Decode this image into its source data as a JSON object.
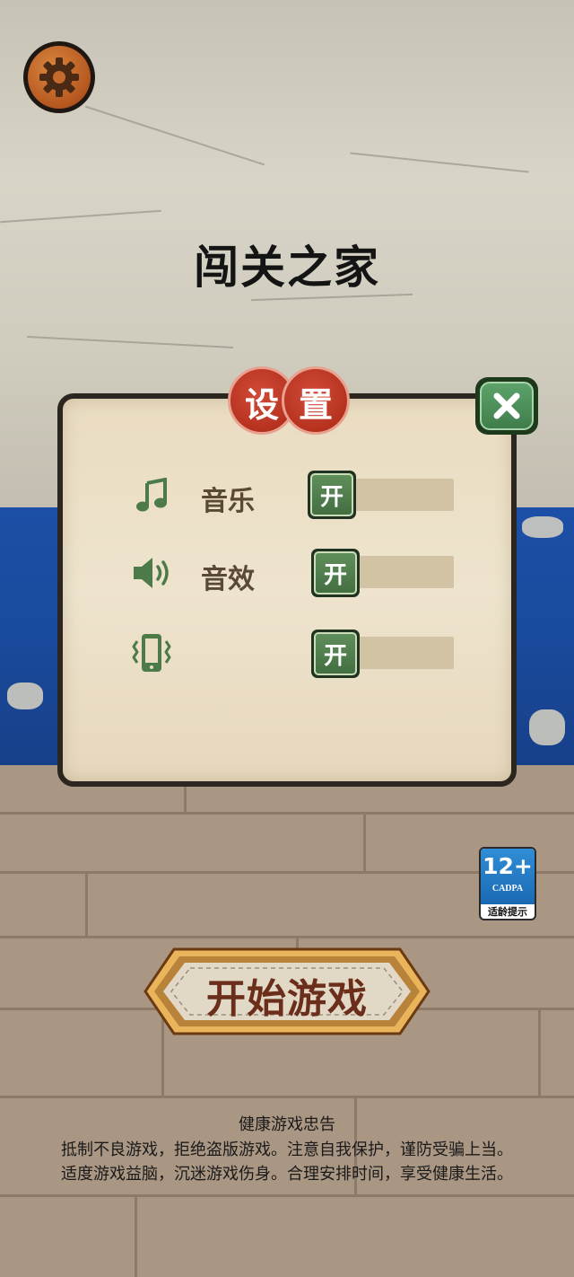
{
  "app_title": "闯关之家",
  "settings_dialog": {
    "title_chars": [
      "设",
      "置"
    ],
    "rows": [
      {
        "icon": "music-note-icon",
        "label": "音乐",
        "toggle_label": "开"
      },
      {
        "icon": "speaker-icon",
        "label": "音效",
        "toggle_label": "开"
      },
      {
        "icon": "vibration-icon",
        "label": "",
        "toggle_label": "开"
      }
    ]
  },
  "age_rating": {
    "age": "12+",
    "org": "CADPA",
    "tip": "适龄提示"
  },
  "start_button": {
    "label": "开始游戏"
  },
  "health_notice": {
    "title": "健康游戏忠告",
    "line1": "抵制不良游戏，拒绝盗版游戏。注意自我保护，谨防受骗上当。",
    "line2": "适度游戏益脑，沉迷游戏伤身。合理安排时间，享受健康生活。"
  },
  "colors": {
    "icon_green": "#4d7a49",
    "toggle_green": "#4f7f4c",
    "ribbon_red": "#c23e2c",
    "close_green": "#4a8c57",
    "start_text": "#6b2e1a",
    "wall_blue": "#1a4a9c"
  }
}
